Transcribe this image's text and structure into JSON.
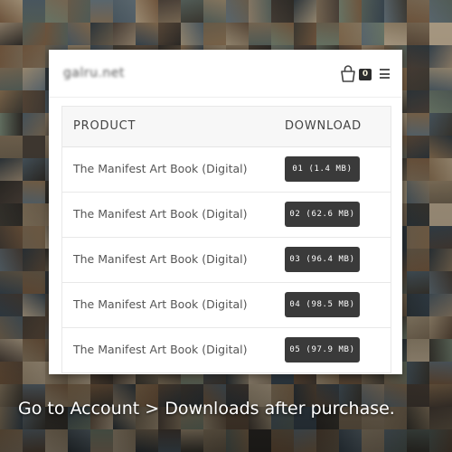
{
  "site": {
    "logo_text": "galru.net"
  },
  "header": {
    "cart_count": "0",
    "cart_icon": "shopping-bag-icon",
    "menu_icon": "hamburger-menu-icon"
  },
  "table": {
    "headers": {
      "product": "PRODUCT",
      "download": "DOWNLOAD"
    },
    "rows": [
      {
        "product": "The Manifest Art Book (Digital)",
        "download": "01 (1.4 MB)"
      },
      {
        "product": "The Manifest Art Book (Digital)",
        "download": "02 (62.6 MB)"
      },
      {
        "product": "The Manifest Art Book (Digital)",
        "download": "03 (96.4 MB)"
      },
      {
        "product": "The Manifest Art Book (Digital)",
        "download": "04 (98.5 MB)"
      },
      {
        "product": "The Manifest Art Book (Digital)",
        "download": "05 (97.9 MB)"
      }
    ]
  },
  "caption": "Go to Account > Downloads after purchase."
}
